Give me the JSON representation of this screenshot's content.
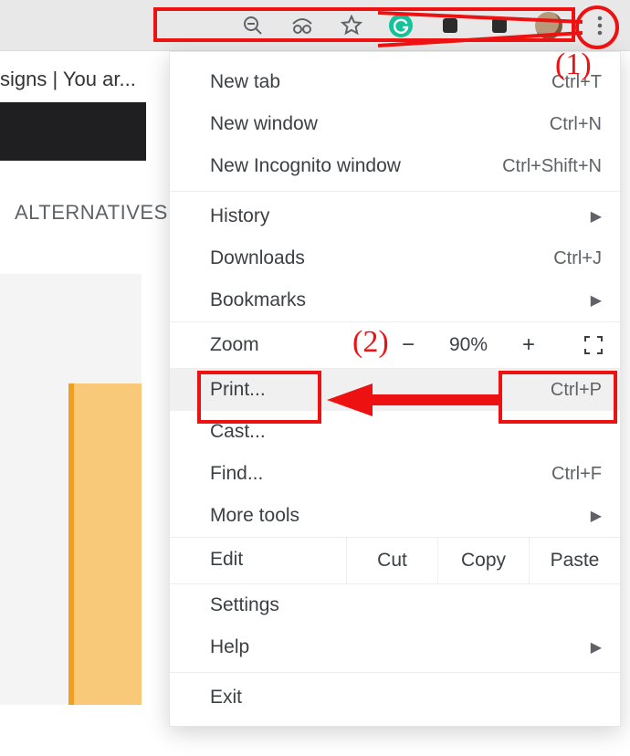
{
  "toolbar": {
    "icons": [
      "zoom-out-icon",
      "incognito-icon",
      "star-icon",
      "grammarly-icon",
      "extension-icon-1",
      "extension-icon-2"
    ]
  },
  "page": {
    "tab_title_snippet": "signs | You ar...",
    "section_label": "ALTERNATIVES"
  },
  "menu": {
    "items": [
      {
        "label": "New tab",
        "shortcut": "Ctrl+T"
      },
      {
        "label": "New window",
        "shortcut": "Ctrl+N"
      },
      {
        "label": "New Incognito window",
        "shortcut": "Ctrl+Shift+N"
      }
    ],
    "history": {
      "label": "History"
    },
    "downloads": {
      "label": "Downloads",
      "shortcut": "Ctrl+J"
    },
    "bookmarks": {
      "label": "Bookmarks"
    },
    "zoom": {
      "label": "Zoom",
      "minus": "−",
      "pct": "90%",
      "plus": "+"
    },
    "print": {
      "label": "Print...",
      "shortcut": "Ctrl+P"
    },
    "cast": {
      "label": "Cast..."
    },
    "find": {
      "label": "Find...",
      "shortcut": "Ctrl+F"
    },
    "more_tools": {
      "label": "More tools"
    },
    "edit": {
      "label": "Edit",
      "cut": "Cut",
      "copy": "Copy",
      "paste": "Paste"
    },
    "settings": {
      "label": "Settings"
    },
    "help": {
      "label": "Help"
    },
    "exit": {
      "label": "Exit"
    }
  },
  "annotations": {
    "num1": "(1)",
    "num2": "(2)",
    "color": "#e11"
  }
}
